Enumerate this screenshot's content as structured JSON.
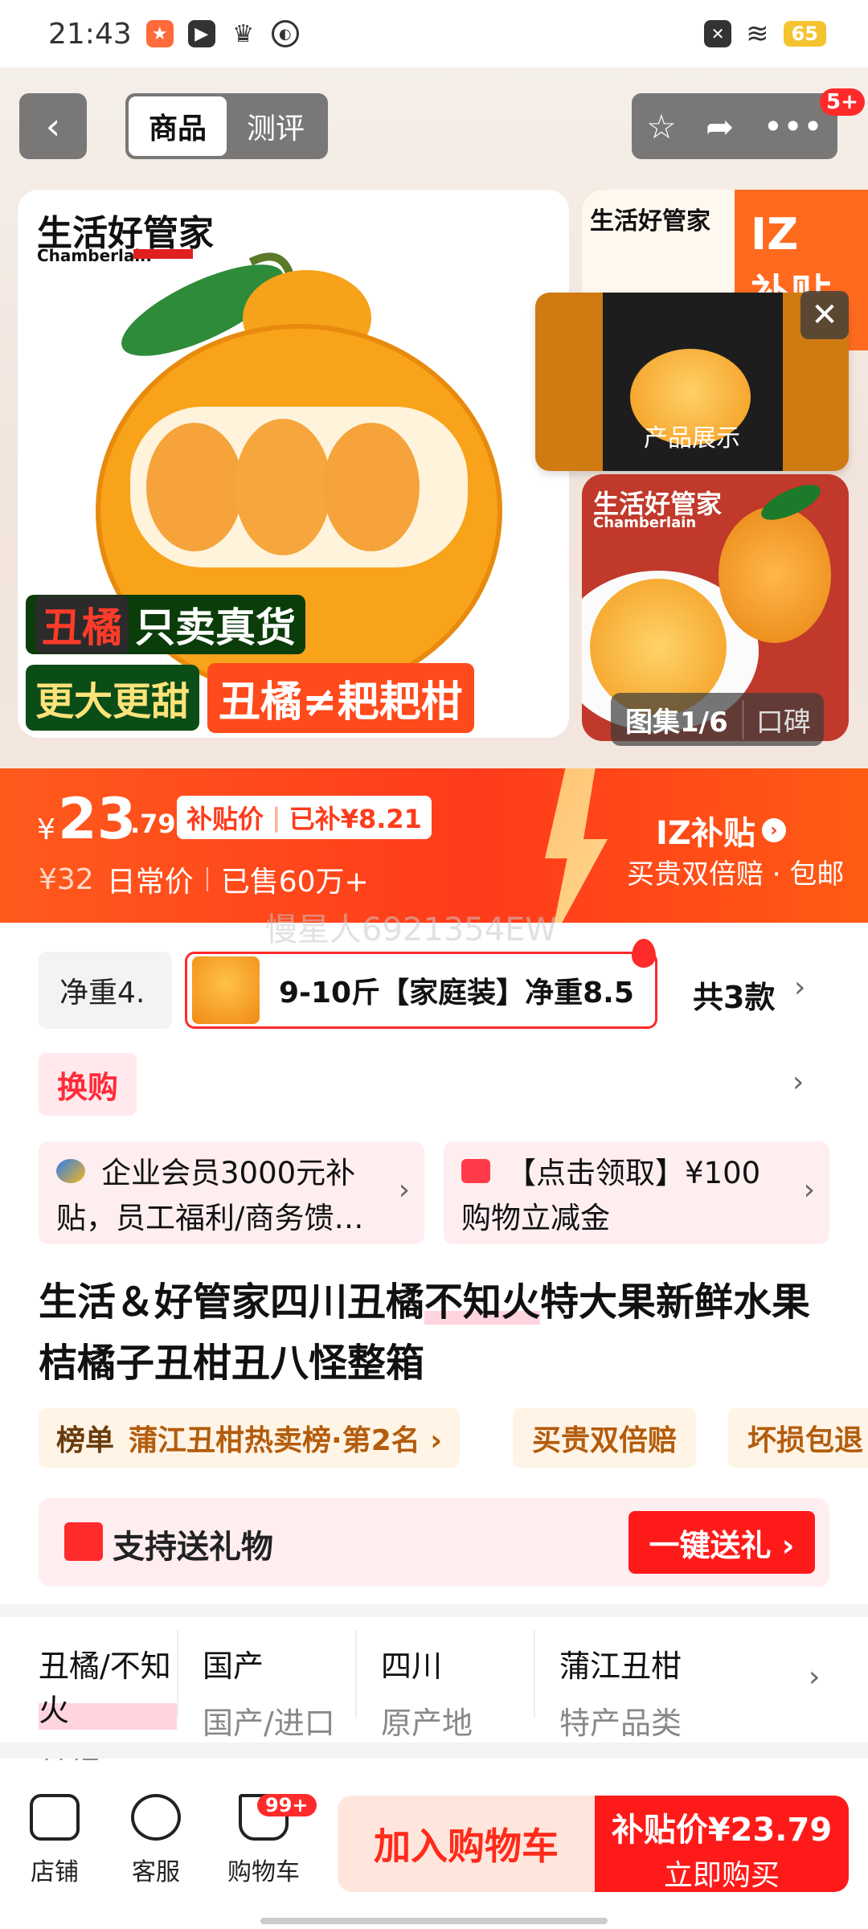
{
  "status": {
    "time": "21:43",
    "battery": "65"
  },
  "nav": {
    "back": "‹",
    "tab_goods": "商品",
    "tab_review": "测评",
    "more_badge": "5+"
  },
  "gallery": {
    "brand": "生活好管家",
    "brand_en": "Chamberlain",
    "tag_a": "丑橘",
    "tag_b": "只卖真货",
    "tag_c": "更大更甜",
    "tag_d": "丑橘≠耙耙柑",
    "thumb_sub_a": "IZ",
    "thumb_sub_b": "补贴",
    "video_label": "产品展示",
    "counter": "图集1/6",
    "counter_b": "口碑"
  },
  "price": {
    "currency": "¥",
    "integer": "23",
    "decimal": ".79",
    "chip_label": "补贴价",
    "chip_saved": "已补¥8.21",
    "orig": "¥32",
    "orig_label": "日常价",
    "sold": "已售60万+",
    "subsidy_brand": "IZ补贴",
    "subsidy_note": "买贵双倍赔 · 包邮"
  },
  "watermark": "慢星人6921354EW",
  "spec": {
    "left": "净重4.",
    "selected": "9-10斤【家庭装】净重8.5",
    "count": "共3款"
  },
  "swap": "换购",
  "coupons": [
    {
      "text": "企业会员3000元补贴，员工福利/商务馈…"
    },
    {
      "text": "【点击领取】¥100购物立减金"
    }
  ],
  "title": {
    "before": "生活＆好管家四川丑橘",
    "highlight": "不知火",
    "after": "特大果新鲜水果桔橘子丑柑丑八怪整箱"
  },
  "rank": {
    "key": "榜单",
    "value": "蒲江丑柑热卖榜·第2名 ›"
  },
  "pills": [
    "买贵双倍赔",
    "坏损包退"
  ],
  "gift": {
    "label": "支持送礼物",
    "button": "一键送礼 ›"
  },
  "attrs": [
    {
      "value": "丑橘/不知火",
      "key": "品种"
    },
    {
      "value": "国产",
      "key": "国产/进口"
    },
    {
      "value": "四川",
      "key": "原产地"
    },
    {
      "value": "蒲江丑柑",
      "key": "特产品类"
    }
  ],
  "bottom": {
    "shop": "店铺",
    "service": "客服",
    "cart": "购物车",
    "cart_badge": "99+",
    "add_cart": "加入购物车",
    "buy_price": "补贴价¥23.79",
    "buy_now": "立即购买"
  }
}
